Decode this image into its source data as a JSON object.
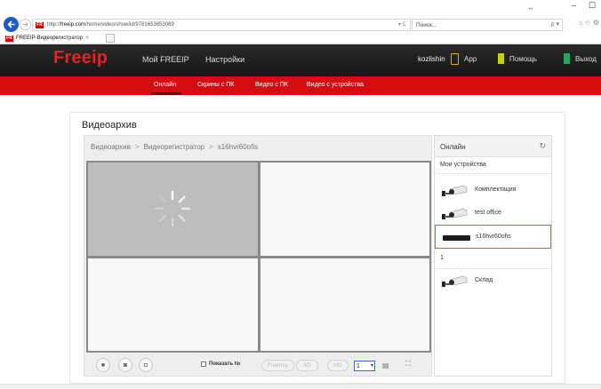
{
  "browser": {
    "url_prefix": "http://",
    "url_host": "freeip.com",
    "url_path": "/home/video/show/id/9781653853069",
    "address_icons": "▾ C",
    "search_placeholder": "Поиск...",
    "search_icons": "ρ ▾",
    "right_icons": "⌂ ☆ ⚙",
    "window_controls": [
      "–",
      "☐"
    ],
    "restore_glyph": "↔",
    "tab_label": "FREEIP-Видеорегистратор",
    "tab_close": "×",
    "favicon_text": "FR"
  },
  "header": {
    "logo": "Freeip",
    "nav": {
      "my": "Мой FREEIP",
      "settings": "Настройки"
    },
    "user": "kozlishin",
    "app": "App",
    "help": "Помощь",
    "exit": "Выход"
  },
  "subnav": {
    "online": "Онлайн",
    "screens": "Скрины с ПК",
    "video_pc": "Видео с ПК",
    "video_device": "Видео с устройства"
  },
  "page": {
    "title": "Видеоархив",
    "breadcrumb": [
      "Видеоархив",
      "Видеорегистратор",
      "s16hvr60ofis"
    ],
    "breadcrumb_sep": ">"
  },
  "controls": {
    "stop_glyph": "■",
    "photo_glyph": "◙",
    "record_glyph": "◘",
    "show_number": "Показать №",
    "fluency": "Fluency",
    "sd": "SD",
    "hd": "HD",
    "layout_value": "1",
    "layout_arrow": "▾",
    "layout_icon": "▤",
    "fullscreen_icon": "⛶"
  },
  "devices": {
    "title": "Онлайн",
    "refresh_glyph": "↻",
    "my_devices": "Мои устройства",
    "items": [
      {
        "label": "Комплектация",
        "type": "camera"
      },
      {
        "label": "test office",
        "type": "camera"
      },
      {
        "label": "s16hvr60ofis",
        "type": "nvr",
        "selected": true
      }
    ],
    "group_label": "1",
    "group_items": [
      {
        "label": "Склад",
        "type": "camera"
      }
    ]
  },
  "colors": {
    "brand_red": "#d40d12",
    "logo_red": "#e02323",
    "header_dark": "#1e1e1e",
    "selection_border": "#e05555"
  }
}
